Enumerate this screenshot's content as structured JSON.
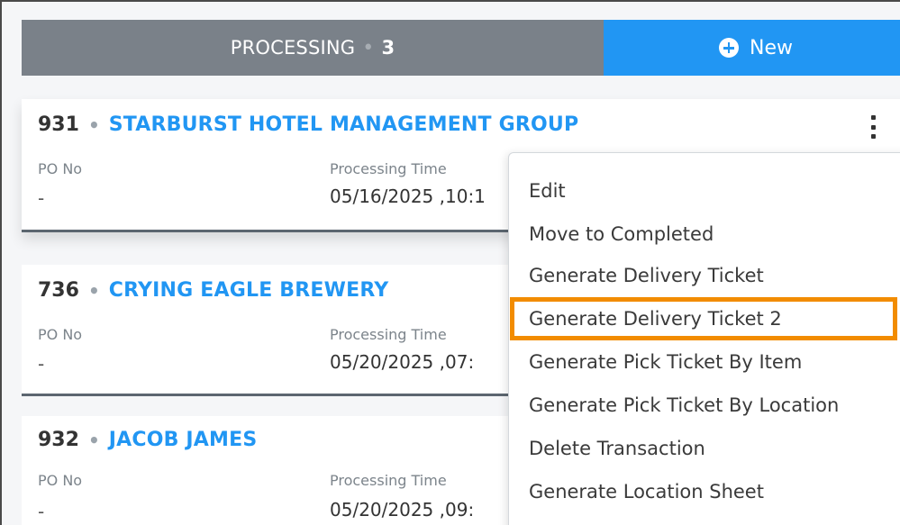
{
  "header": {
    "processing_label": "PROCESSING",
    "separator": "•",
    "processing_count": "3",
    "new_label": "New"
  },
  "cards": [
    {
      "number": "931",
      "separator": "•",
      "name": "STARBURST HOTEL MANAGEMENT GROUP",
      "po_label": "PO No",
      "po_value": "-",
      "time_label": "Processing Time",
      "time_value": "05/16/2025 ,10:1"
    },
    {
      "number": "736",
      "separator": "•",
      "name": "CRYING EAGLE BREWERY",
      "po_label": "PO No",
      "po_value": "-",
      "time_label": "Processing Time",
      "time_value": "05/20/2025 ,07:"
    },
    {
      "number": "932",
      "separator": "•",
      "name": "JACOB JAMES",
      "po_label": "PO No",
      "po_value": "-",
      "time_label": "Processing Time",
      "time_value": "05/20/2025 ,09:"
    }
  ],
  "menu": {
    "items": [
      "Edit",
      "Move to Completed",
      "Generate Delivery Ticket",
      "Generate Delivery Ticket 2",
      "Generate Pick Ticket By Item",
      "Generate Pick Ticket By Location",
      "Delete Transaction",
      "Generate Location Sheet"
    ],
    "highlighted_index": 3
  },
  "colors": {
    "processing_bg": "#7a8189",
    "new_bg": "#2196f3",
    "link": "#2196f3",
    "highlight": "#f28c00"
  },
  "icons": {
    "new": "plus-circle-icon",
    "card_menu": "kebab-menu-icon"
  }
}
